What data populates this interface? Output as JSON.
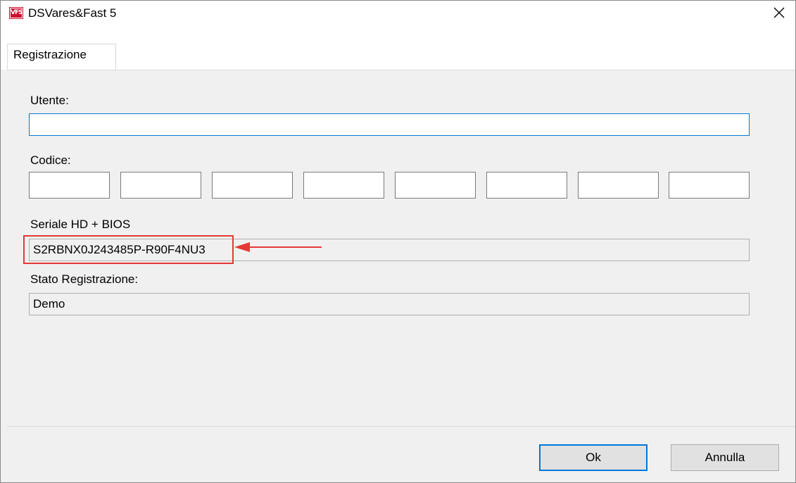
{
  "window": {
    "title": "DSVares&Fast 5",
    "icon_text": "VFS",
    "icon": "app-logo-icon",
    "close_icon": "close-icon"
  },
  "tabs": [
    {
      "label": "Registrazione",
      "selected": true
    }
  ],
  "form": {
    "utente_label": "Utente:",
    "utente_value": "",
    "codice_label": "Codice:",
    "codice_values": [
      "",
      "",
      "",
      "",
      "",
      "",
      "",
      ""
    ],
    "seriale_label": "Seriale HD + BIOS",
    "seriale_value": "S2RBNX0J243485P-R90F4NU3",
    "stato_label": "Stato Registrazione:",
    "stato_value": "Demo"
  },
  "annotation": {
    "color": "#e53935",
    "shape": "rectangle-with-arrow"
  },
  "buttons": {
    "ok_label": "Ok",
    "cancel_label": "Annulla"
  },
  "colors": {
    "accent": "#0078d7",
    "window_bg": "#f0f0f0",
    "brand": "#c8102e"
  }
}
